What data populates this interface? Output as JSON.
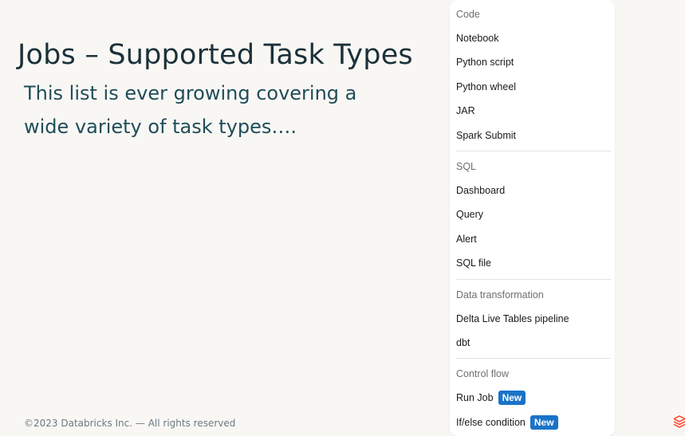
{
  "slide": {
    "title": "Jobs – Supported Task Types",
    "subtitle": "This list is ever growing covering a wide variety of task types….",
    "footer": "©2023 Databricks Inc. — All rights reserved",
    "logo_icon": "databricks-logo-icon"
  },
  "menu": {
    "sections": [
      {
        "header": "Code",
        "items": [
          {
            "label": "Notebook"
          },
          {
            "label": "Python script"
          },
          {
            "label": "Python wheel"
          },
          {
            "label": "JAR"
          },
          {
            "label": "Spark Submit"
          }
        ]
      },
      {
        "header": "SQL",
        "items": [
          {
            "label": "Dashboard"
          },
          {
            "label": "Query"
          },
          {
            "label": "Alert"
          },
          {
            "label": "SQL file"
          }
        ]
      },
      {
        "header": "Data transformation",
        "items": [
          {
            "label": "Delta Live Tables pipeline"
          },
          {
            "label": "dbt"
          }
        ]
      },
      {
        "header": "Control flow",
        "items": [
          {
            "label": "Run Job",
            "badge": "New"
          },
          {
            "label": "If/else condition",
            "badge": "New"
          }
        ]
      }
    ]
  },
  "colors": {
    "background": "#f9f7f4",
    "title": "#1b3139",
    "subtitle": "#1f4d59",
    "badge": "#1a73c8",
    "logo": "#ff3621"
  }
}
